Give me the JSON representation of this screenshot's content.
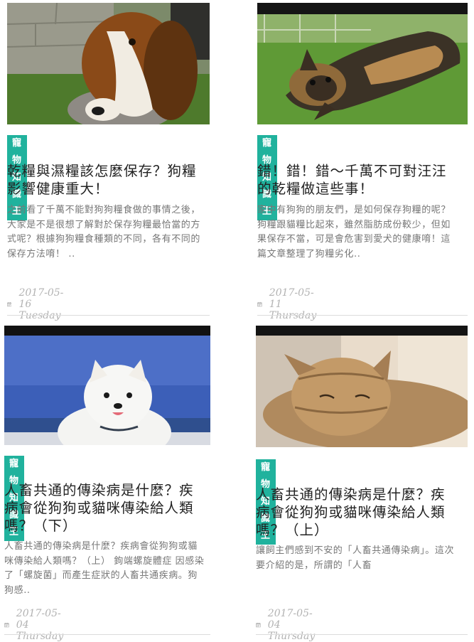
{
  "articles": [
    {
      "image": "beagle-eating-photo",
      "tag": "寵物知識王",
      "title": "乾糧與濕糧該怎麼保存？狗糧影響健康重大！",
      "excerpt": "之前看了千萬不能對狗狗糧食做的事情之後，大家是不是很想了解對於保存狗糧最恰當的方式呢？根據狗狗糧食種類的不同，各有不同的保存方法唷！ ..",
      "date": "2017-05-16 Tuesday"
    },
    {
      "image": "yorkshire-terrier-on-grass-photo",
      "tag": "寵物知識王",
      "title": "錯！錯！錯～千萬不可對汪汪的乾糧做這些事！",
      "excerpt": "家中有狗狗的朋友們，是如何保存狗糧的呢？狗糧跟貓糧比起來，雖然脂肪成份較少，但如果保存不當，可是會危害到愛犬的健康唷！這篇文章整理了狗糧劣化..",
      "date": "2017-05-11 Thursday"
    },
    {
      "image": "white-puppy-at-beach-photo",
      "tag": "寵物知識王",
      "title": "人畜共通的傳染病是什麼？疾病會從狗狗或貓咪傳染給人類嗎？（下）",
      "excerpt": "人畜共通的傳染病是什麼？疾病會從狗狗或貓咪傳染給人類嗎？（上） 鉤端螺旋體症 因感染了「螺旋菌」而產生症狀的人畜共通疾病。狗狗感..",
      "date": "2017-05-04 Thursday"
    },
    {
      "image": "tabby-cat-resting-photo",
      "tag": "寵物知識王",
      "title": "人畜共通的傳染病是什麼？疾病會從狗狗或貓咪傳染給人類嗎？（上）",
      "excerpt": "讓飼主們感到不安的「人畜共通傳染病」。這次要介紹的是，所謂的「人畜",
      "date": "2017-05-04 Thursday"
    }
  ],
  "icons": {
    "date": "calendar-icon"
  },
  "colors": {
    "tag_bg": "#20b29d",
    "date_text": "#b3b3b3"
  }
}
